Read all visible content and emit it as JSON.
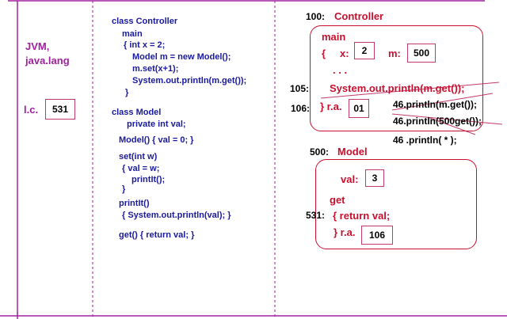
{
  "jvm": {
    "title": "JVM,",
    "package": "java.lang",
    "lc_label": "l.c.",
    "lc_value": "531"
  },
  "code": {
    "lines": [
      "class Controller",
      "main",
      "{ int x = 2;",
      "Model m = new Model();",
      "m.set(x+1);",
      "System.out.println(m.get());",
      "}",
      "class Model",
      "private int val;",
      "Model()  { val = 0; }",
      "set(int w)",
      "{ val = w;",
      "printIt();",
      "}",
      "printIt()",
      "{  System.out.println(val); }",
      "get()   { return val; }"
    ]
  },
  "memory": {
    "controller_addr": "100:",
    "controller_name": "Controller",
    "main_label": "main",
    "brace": "{",
    "x_label": "x:",
    "x_value": "2",
    "m_label": "m:",
    "m_value": "500",
    "dots": ". . .",
    "line105_addr": "105:",
    "line105_code": "System.out.println(m.get());",
    "line106_addr": "106:",
    "ra1_label": "} r.a.",
    "ra1_value": "01",
    "r46a": "46.println(m.get());",
    "r46b_pre": "46.println(",
    "r46b_val": "500",
    "r46b_post": "get());",
    "r46c": "46 .println( * );",
    "model_addr": "500:",
    "model_name": "Model",
    "val_label": "val:",
    "val_value": "3",
    "get_label": "get",
    "line531_addr": "531:",
    "return_code": "{ return val;",
    "ra2_label": "} r.a.",
    "ra2_value": "106"
  }
}
